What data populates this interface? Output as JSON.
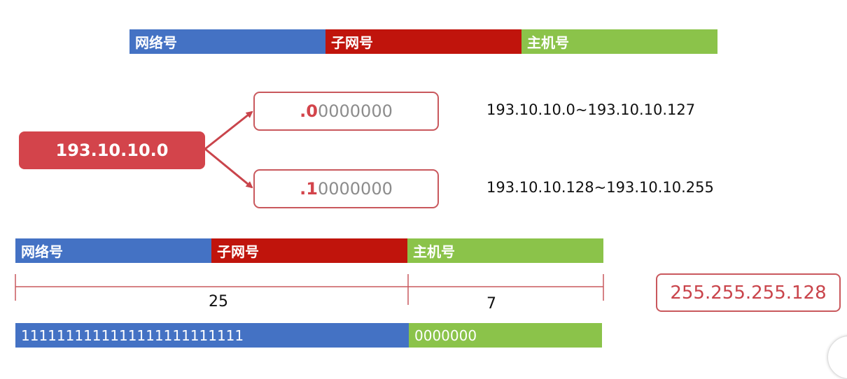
{
  "top_bar": {
    "network_label": "网络号",
    "subnet_label": "子网号",
    "host_label": "主机号"
  },
  "split": {
    "source_ip": "193.10.10.0",
    "branch_0": {
      "prefix": ".",
      "bit": "0",
      "rest": "0000000",
      "range": "193.10.10.0~193.10.10.127"
    },
    "branch_1": {
      "prefix": ".",
      "bit": "1",
      "rest": "0000000",
      "range": "193.10.10.128~193.10.10.255"
    }
  },
  "bottom_bar": {
    "network_label": "网络号",
    "subnet_label": "子网号",
    "host_label": "主机号"
  },
  "bit_counts": {
    "network_bits": "25",
    "host_bits": "7"
  },
  "mask_bits": {
    "ones": "1111111111111111111111111",
    "zeros": "0000000"
  },
  "subnet_mask": "255.255.255.128",
  "colors": {
    "network": "#4472c4",
    "subnet": "#c0140c",
    "host": "#8bc34a",
    "accent_red": "#d3444b"
  }
}
